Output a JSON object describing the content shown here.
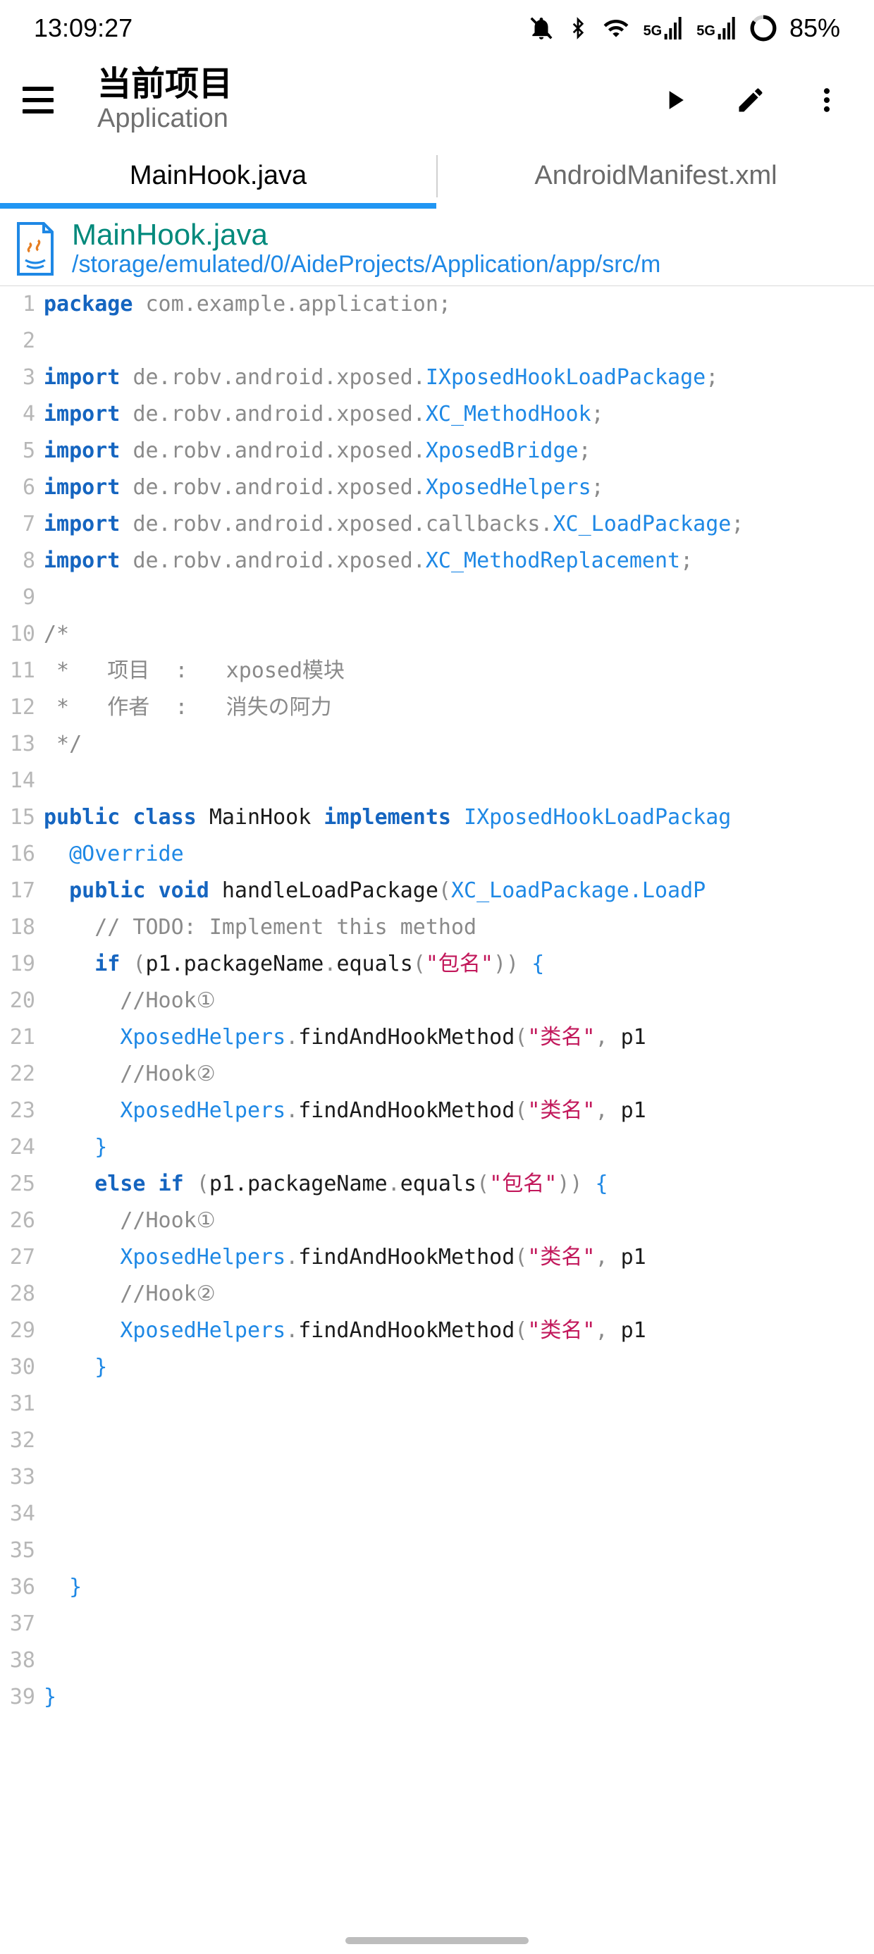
{
  "status": {
    "time": "13:09:27",
    "battery": "85%"
  },
  "appbar": {
    "title": "当前项目",
    "subtitle": "Application"
  },
  "tabs": [
    {
      "label": "MainHook.java",
      "active": true
    },
    {
      "label": "AndroidManifest.xml",
      "active": false
    }
  ],
  "file": {
    "name": "MainHook.java",
    "path": "/storage/emulated/0/AideProjects/Application/app/src/m"
  },
  "code": {
    "package_kw": "package",
    "import_kw": "import",
    "public_kw": "public",
    "class_kw": "class",
    "void_kw": "void",
    "if_kw": "if",
    "else_kw": "else",
    "implements_kw": "implements",
    "override_ann": "@Override",
    "pkg_name": "com.example.application",
    "imp_base": "de.robv.android.xposed",
    "imp1": "IXposedHookLoadPackage",
    "imp2": "XC_MethodHook",
    "imp3": "XposedBridge",
    "imp4": "XposedHelpers",
    "imp5_base": "de.robv.android.xposed.callbacks",
    "imp5": "XC_LoadPackage",
    "imp6": "XC_MethodReplacement",
    "cmt_open": "/*",
    "cmt_l1": " *   项目  :   xposed模块",
    "cmt_l2": " *   作者  :   消失の阿力",
    "cmt_close": " */",
    "class_name": "MainHook",
    "implements_type": "IXposedHookLoadPackag",
    "method_name": "handleLoadPackage",
    "method_param_type": "XC_LoadPackage.LoadP",
    "todo": "// TODO: Implement this method",
    "p1_pkg": "p1.packageName",
    "equals": "equals",
    "str_pkg": "\"包名\"",
    "hook1": "//Hook①",
    "hook2": "//Hook②",
    "XposedHelpers": "XposedHelpers",
    "findAndHookMethod": "findAndHookMethod",
    "str_cls": "\"类名\"",
    "p1": "p1"
  },
  "line_count": 39
}
